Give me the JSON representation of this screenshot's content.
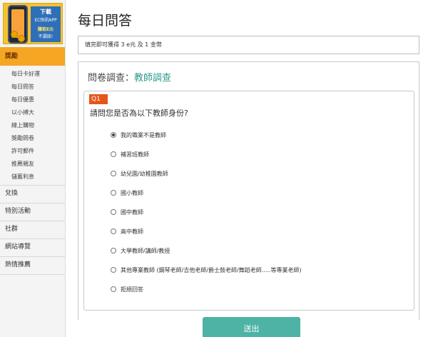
{
  "sidebar": {
    "banner": {
      "line1": "下載",
      "line2": "EC快訊APP",
      "line3": "賺取E元",
      "line4": "不漏接!"
    },
    "active_section": "獎勵",
    "sub_items": [
      "每日卡好運",
      "每日問答",
      "每日優惠",
      "以小搏大",
      "線上購物",
      "獎勵問卷",
      "許可郵件",
      "推薦親友",
      "儲蓄利息"
    ],
    "sections": [
      "兌換",
      "特別活動",
      "社群",
      "網站導覽",
      "熱情推薦"
    ]
  },
  "main": {
    "title": "每日問答",
    "notice": "填完即可獲得 3 e元 及 1 金幣",
    "survey_label": "問卷調查：",
    "survey_name": "教師調查",
    "question_number": "Q1",
    "question": "請問您是否為以下教師身份?",
    "options": [
      "我的職業不是教師",
      "補習班教師",
      "幼兒園/幼稚園教師",
      "國小教師",
      "國中教師",
      "高中教師",
      "大學教師/講師/教授",
      "其他專業教師 (鋼琴老師/吉他老師/爵士鼓老師/舞蹈老師.....等專業老師)",
      "拒絕回答"
    ],
    "selected_option": "我的職業不是教師",
    "submit_label": "送出"
  }
}
